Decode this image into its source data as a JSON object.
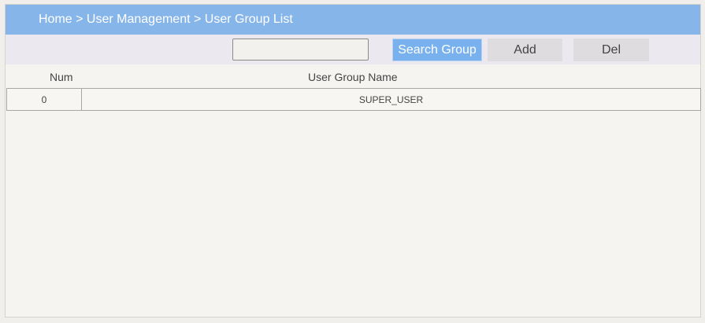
{
  "header": {
    "breadcrumb": "Home > User Management > User Group List"
  },
  "toolbar": {
    "search": {
      "value": "",
      "placeholder": ""
    },
    "search_button_label": "Search Group",
    "add_button_label": "Add",
    "del_button_label": "Del"
  },
  "table": {
    "columns": [
      "Num",
      "User Group Name"
    ],
    "rows": [
      {
        "num": "0",
        "name": "SUPER_USER"
      }
    ]
  },
  "colors": {
    "header_bg": "#86b5ea",
    "accent_button": "#79b1ee",
    "secondary_button": "#dedcde"
  }
}
